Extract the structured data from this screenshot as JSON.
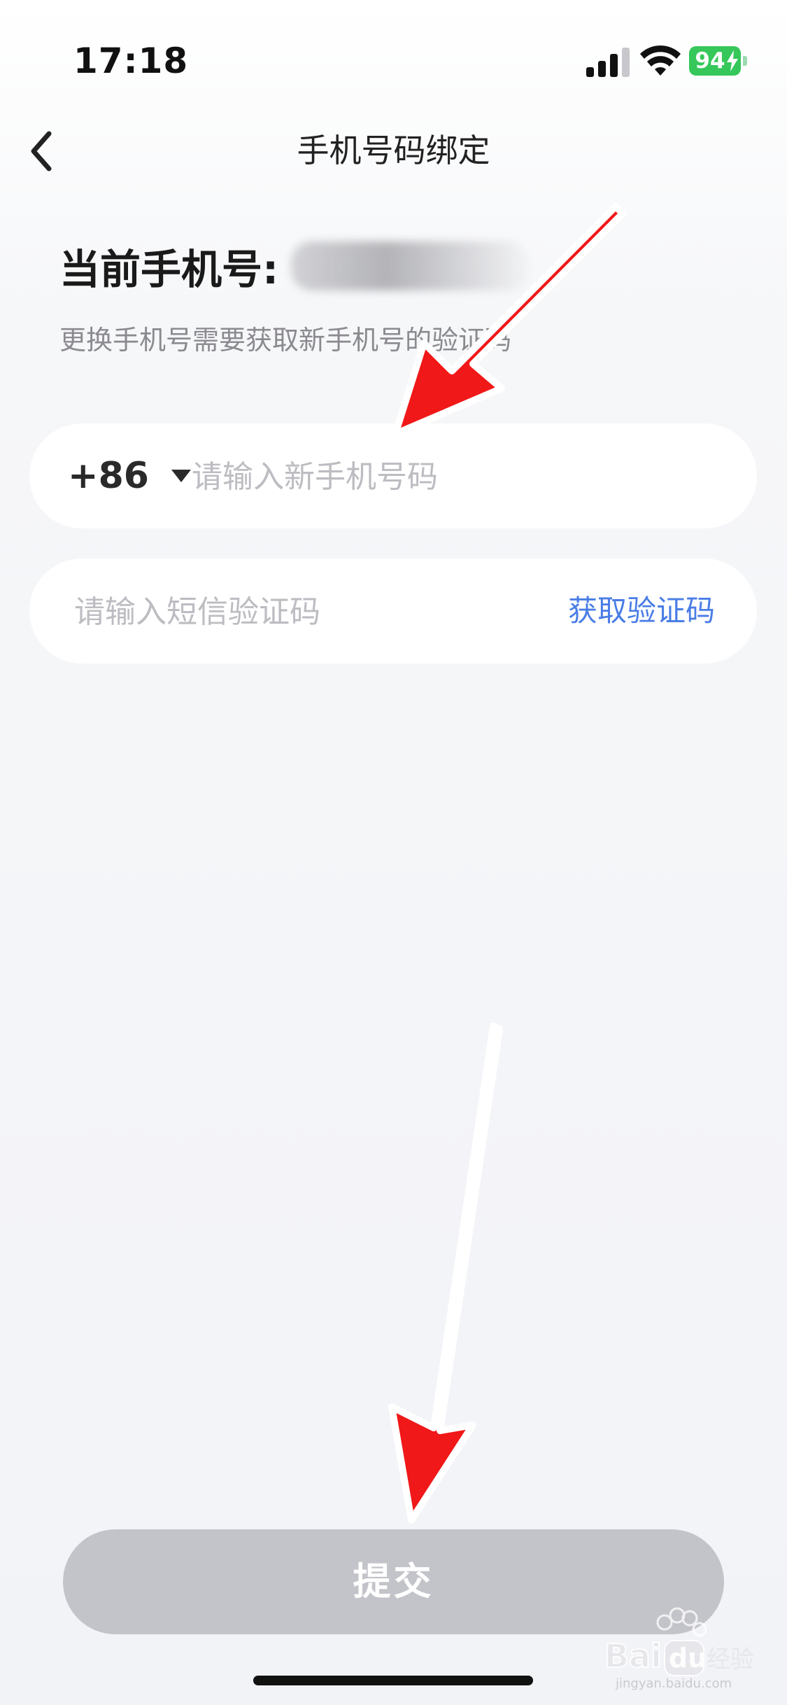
{
  "status_bar": {
    "time": "17:18",
    "battery": "94"
  },
  "nav": {
    "title": "手机号码绑定"
  },
  "current_phone": {
    "label": "当前手机号:"
  },
  "subtitle": "更换手机号需要获取新手机号的验证码",
  "phone_input": {
    "country_code": "+86",
    "placeholder": "请输入新手机号码",
    "value": ""
  },
  "code_input": {
    "placeholder": "请输入短信验证码",
    "value": "",
    "get_code_label": "获取验证码"
  },
  "submit_label": "提交",
  "watermark": {
    "text": "jingyan.baidu.com"
  },
  "colors": {
    "accent": "#4a7de6",
    "submit_disabled": "#c3c3ca",
    "battery": "#35c759",
    "annotation_arrow": "#f01818"
  }
}
